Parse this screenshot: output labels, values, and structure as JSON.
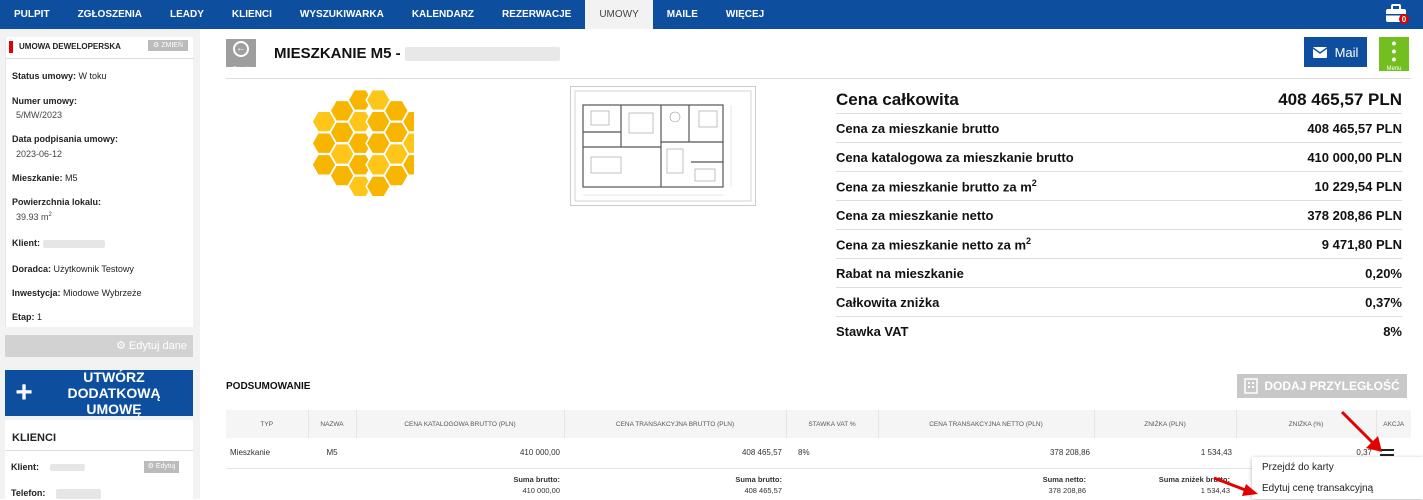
{
  "nav": {
    "items": [
      "PULPIT",
      "ZGŁOSZENIA",
      "LEADY",
      "KLIENCI",
      "WYSZUKIWARKA",
      "KALENDARZ",
      "REZERWACJE",
      "UMOWY",
      "MAILE",
      "WIĘCEJ"
    ],
    "active": "UMOWY",
    "badge": "0"
  },
  "sidebar": {
    "umowa_title": "UMOWA DEWELOPERSKA",
    "zmien_label": "ZMIEŃ",
    "status_label": "Status umowy:",
    "status_value": "W toku",
    "numer_label": "Numer umowy:",
    "numer_value": "5/MW/2023",
    "data_label": "Data podpisania umowy:",
    "data_value": "2023-06-12",
    "mieszkanie_label": "Mieszkanie:",
    "mieszkanie_value": "M5",
    "powierzchnia_label": "Powierzchnia lokalu:",
    "powierzchnia_value": "39.93 m",
    "powierzchnia_sup": "2",
    "klient_label": "Klient:",
    "doradca_label": "Doradca:",
    "doradca_value": "Użytkownik Testowy",
    "inwestycja_label": "Inwestycja:",
    "inwestycja_value": "Miodowe Wybrzeże",
    "etap_label": "Etap:",
    "etap_value": "1",
    "edit_label": "Edytuj dane",
    "create_label": "UTWÓRZ DODATKOWĄ UMOWĘ",
    "klienci_title": "KLIENCI",
    "klient2_label": "Klient:",
    "edytuj_small": "Edytuj",
    "telefon_label": "Telefon:"
  },
  "header": {
    "back_label": "Powrót",
    "title": "MIESZKANIE M5 -",
    "mail_label": "Mail",
    "menu_label": "Menu"
  },
  "prices": [
    {
      "label": "Cena całkowita",
      "value": "408 465,57 PLN",
      "big": true
    },
    {
      "label": "Cena za mieszkanie brutto",
      "value": "408 465,57 PLN"
    },
    {
      "label": "Cena katalogowa za mieszkanie brutto",
      "value": "410 000,00 PLN"
    },
    {
      "label": "Cena za mieszkanie brutto za m",
      "sup": "2",
      "value": "10 229,54 PLN"
    },
    {
      "label": "Cena za mieszkanie netto",
      "value": "378 208,86 PLN"
    },
    {
      "label": "Cena za mieszkanie netto za m",
      "sup": "2",
      "value": "9 471,80 PLN"
    },
    {
      "label": "Rabat na mieszkanie",
      "value": "0,20%"
    },
    {
      "label": "Całkowita zniżka",
      "value": "0,37%"
    },
    {
      "label": "Stawka VAT",
      "value": "8%"
    }
  ],
  "summary": {
    "title": "PODSUMOWANIE",
    "add_label": "DODAJ PRZYLEGŁOŚĆ",
    "columns": [
      "TYP",
      "NAZWA",
      "CENA KATALOGOWA BRUTTO (PLN)",
      "CENA TRANSAKCYJNA BRUTTO (PLN)",
      "STAWKA VAT %",
      "CENA TRANSAKCYJNA NETTO (PLN)",
      "ZNIŻKA (PLN)",
      "ZNIŻKA (%)",
      "AKCJA"
    ],
    "row": {
      "typ": "Mieszkanie",
      "nazwa": "M5",
      "katalogowa": "410 000,00",
      "transakcyjna": "408 465,57",
      "vat": "8%",
      "netto": "378 208,86",
      "znizka_pln": "1 534,43",
      "znizka_pct": "0,37"
    },
    "sums": {
      "brutto_kat_label": "Suma brutto:",
      "brutto_kat_value": "410 000,00",
      "brutto_tr_label": "Suma brutto:",
      "brutto_tr_value": "408 465,57",
      "netto_label": "Suma netto:",
      "netto_value": "378 208,86",
      "znizek_label": "Suma zniżek brutto:",
      "znizek_value": "1 534,43"
    }
  },
  "context_menu": {
    "item1": "Przejdź do karty",
    "item2": "Edytuj cenę transakcyjną"
  },
  "colors": {
    "nav": "#0d4f9e",
    "menu_green": "#72bf1f",
    "arrow_red": "#e20000",
    "honey": "#f7b500"
  }
}
